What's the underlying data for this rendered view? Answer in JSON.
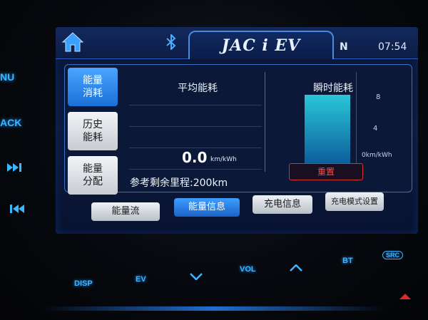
{
  "left_keys": {
    "menu_partial": "NU",
    "back_partial": "ACK",
    "next_icon": "skip-forward-icon",
    "prev_icon": "skip-back-icon"
  },
  "header": {
    "home_icon": "home-icon",
    "bluetooth_icon": "bluetooth-icon",
    "title": "JAC i EV",
    "gear": "N",
    "time": "07:54"
  },
  "tabs": [
    {
      "label": "能量\n消耗",
      "active": true
    },
    {
      "label": "历史\n能耗",
      "active": false
    },
    {
      "label": "能量\n分配",
      "active": false
    }
  ],
  "average": {
    "title": "平均能耗",
    "value": "0.0",
    "unit": "km/kWh"
  },
  "instant": {
    "title": "瞬时能耗",
    "ticks": [
      "8",
      "4",
      "0km/kWh"
    ],
    "bar_level": 0.98,
    "reset_label": "重置"
  },
  "remaining_range": "参考剩余里程:200km",
  "bottom_buttons": [
    {
      "label": "能量流",
      "active": false
    },
    {
      "label": "能量信息",
      "active": true
    },
    {
      "label": "充电信息",
      "active": false
    },
    {
      "label": "充电模式设置",
      "active": false
    }
  ],
  "console": {
    "disp": "DISP",
    "ev": "EV",
    "vol": "VOL",
    "bt": "BT",
    "src": "SRC"
  },
  "colors": {
    "accent": "#39b7ff",
    "active_tab": "#1a6fd8",
    "reset": "#ff4b4b"
  }
}
